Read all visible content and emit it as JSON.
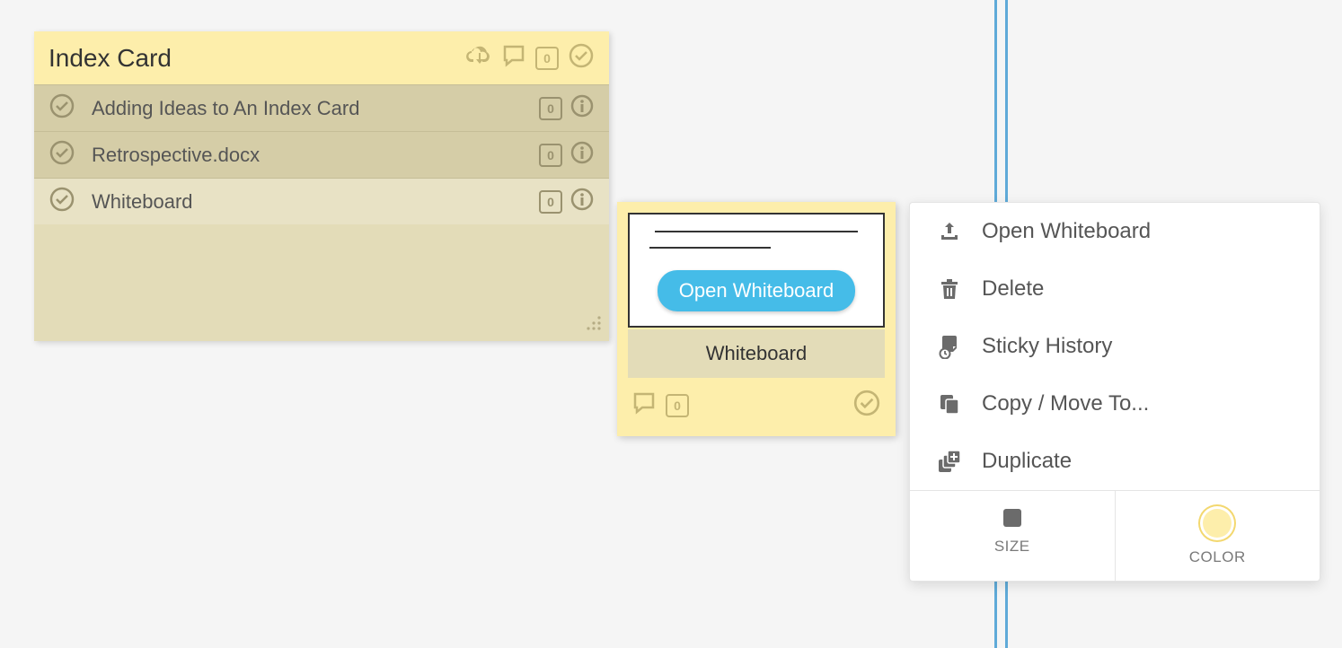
{
  "index_card": {
    "title": "Index Card",
    "header_count": "0",
    "rows": [
      {
        "label": "Adding Ideas to An Index Card",
        "count": "0",
        "selected": false
      },
      {
        "label": "Retrospective.docx",
        "count": "0",
        "selected": false
      },
      {
        "label": "Whiteboard",
        "count": "0",
        "selected": true
      }
    ]
  },
  "sticky": {
    "open_label": "Open Whiteboard",
    "caption": "Whiteboard",
    "count": "0"
  },
  "context_menu": {
    "items": [
      {
        "label": "Open Whiteboard",
        "icon": "upload-icon"
      },
      {
        "label": "Delete",
        "icon": "trash-icon"
      },
      {
        "label": "Sticky History",
        "icon": "history-icon"
      },
      {
        "label": "Copy / Move To...",
        "icon": "copy-icon"
      },
      {
        "label": "Duplicate",
        "icon": "duplicate-icon"
      }
    ],
    "footer": {
      "size_label": "SIZE",
      "color_label": "COLOR"
    }
  }
}
